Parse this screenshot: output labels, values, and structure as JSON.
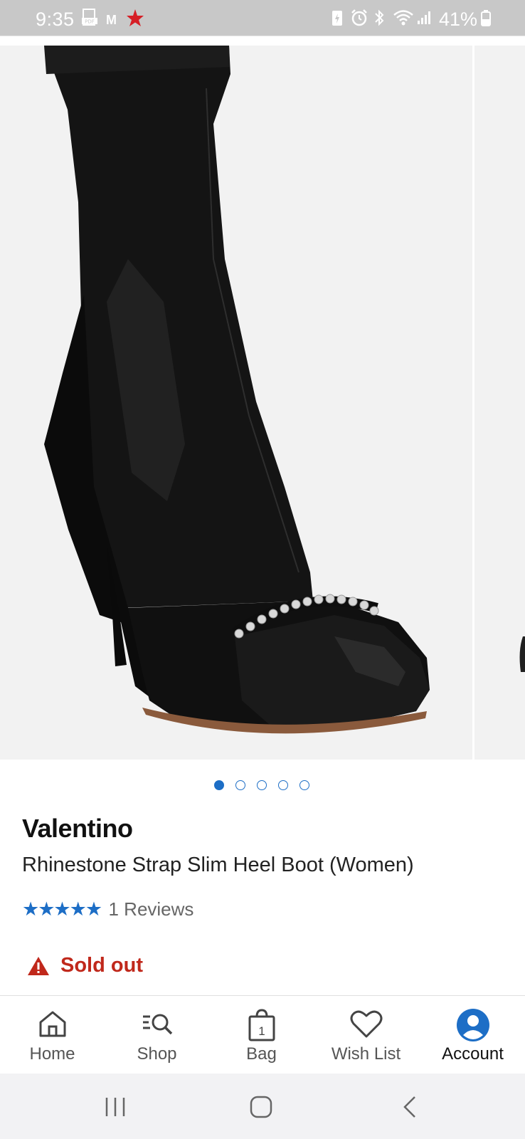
{
  "status_bar": {
    "time": "9:35",
    "battery_percent": "41%",
    "left_icons": [
      "pdf-icon",
      "gmail-icon",
      "star-icon"
    ],
    "right_icons": [
      "battery-saver-icon",
      "alarm-icon",
      "bluetooth-icon",
      "wifi-icon",
      "signal-icon",
      "battery-icon"
    ]
  },
  "gallery": {
    "image_count": 5,
    "active_index": 0
  },
  "product": {
    "brand": "Valentino",
    "name": "Rhinestone Strap Slim Heel Boot (Women)",
    "rating_stars": "★★★★★",
    "rating_value": 5,
    "reviews": "1 Reviews",
    "availability": "Sold out"
  },
  "bottom_nav": {
    "items": [
      {
        "label": "Home",
        "icon": "home-icon"
      },
      {
        "label": "Shop",
        "icon": "shop-search-icon"
      },
      {
        "label": "Bag",
        "icon": "bag-icon",
        "badge": "1"
      },
      {
        "label": "Wish List",
        "icon": "heart-icon"
      },
      {
        "label": "Account",
        "icon": "account-icon"
      }
    ],
    "active": "Account"
  },
  "colors": {
    "accent": "#1d6ec6",
    "sold_out": "#c0281b",
    "status_bar": "#c8c8c8",
    "gallery_bg": "#f2f2f2"
  }
}
